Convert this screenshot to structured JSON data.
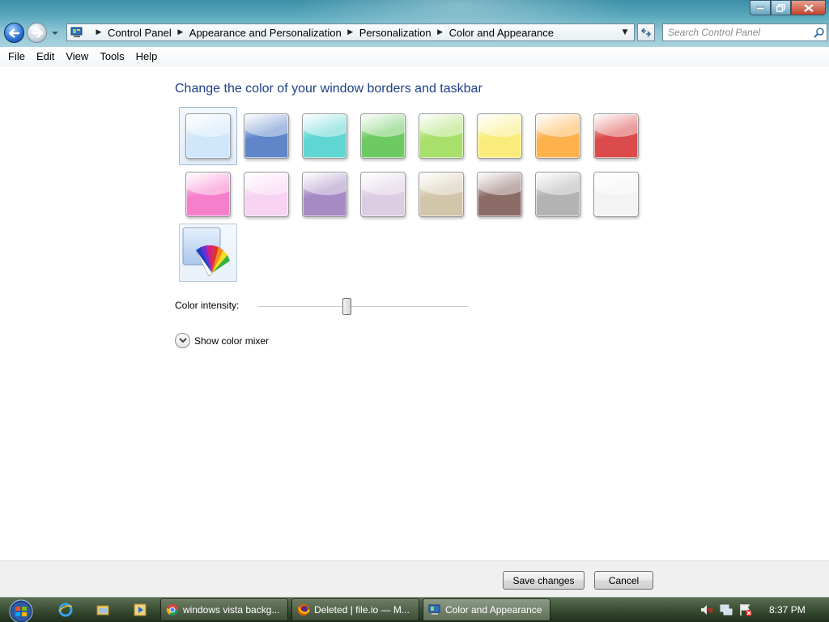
{
  "window": {
    "breadcrumbs": [
      "Control Panel",
      "Appearance and Personalization",
      "Personalization",
      "Color and Appearance"
    ],
    "search_placeholder": "Search Control Panel"
  },
  "menu": [
    "File",
    "Edit",
    "View",
    "Tools",
    "Help"
  ],
  "main": {
    "title": "Change the color of your window borders and taskbar",
    "swatches": [
      {
        "name": "default",
        "color": "#cfe6fb",
        "selected": true
      },
      {
        "name": "graphite-blue",
        "color": "#5f86c9"
      },
      {
        "name": "teal",
        "color": "#5fd6d2"
      },
      {
        "name": "green",
        "color": "#6dca63"
      },
      {
        "name": "lime",
        "color": "#a9e06b"
      },
      {
        "name": "yellow",
        "color": "#f9ec7a"
      },
      {
        "name": "orange",
        "color": "#fdb24e"
      },
      {
        "name": "red",
        "color": "#db4b4b"
      },
      {
        "name": "pink",
        "color": "#f57fcb"
      },
      {
        "name": "frost-pink",
        "color": "#f8d2f3"
      },
      {
        "name": "violet",
        "color": "#a68ac3"
      },
      {
        "name": "lavender",
        "color": "#ddcde2"
      },
      {
        "name": "sand",
        "color": "#d2c6aa"
      },
      {
        "name": "brown",
        "color": "#8b6b66"
      },
      {
        "name": "gray",
        "color": "#b3b3b3"
      },
      {
        "name": "white",
        "color": "#f3f3f3"
      }
    ],
    "intensity_label": "Color intensity:",
    "intensity_value": 0.42,
    "mixer_label": "Show color mixer"
  },
  "footer": {
    "save_label": "Save changes",
    "cancel_label": "Cancel"
  },
  "taskbar": {
    "tasks": [
      {
        "label": "windows vista backg...",
        "icon": "chrome-icon",
        "active": false
      },
      {
        "label": "Deleted | file.io — M...",
        "icon": "firefox-icon",
        "active": false
      },
      {
        "label": "Color and Appearance",
        "icon": "control-panel-icon",
        "active": true
      }
    ],
    "clock": "8:37 PM"
  }
}
